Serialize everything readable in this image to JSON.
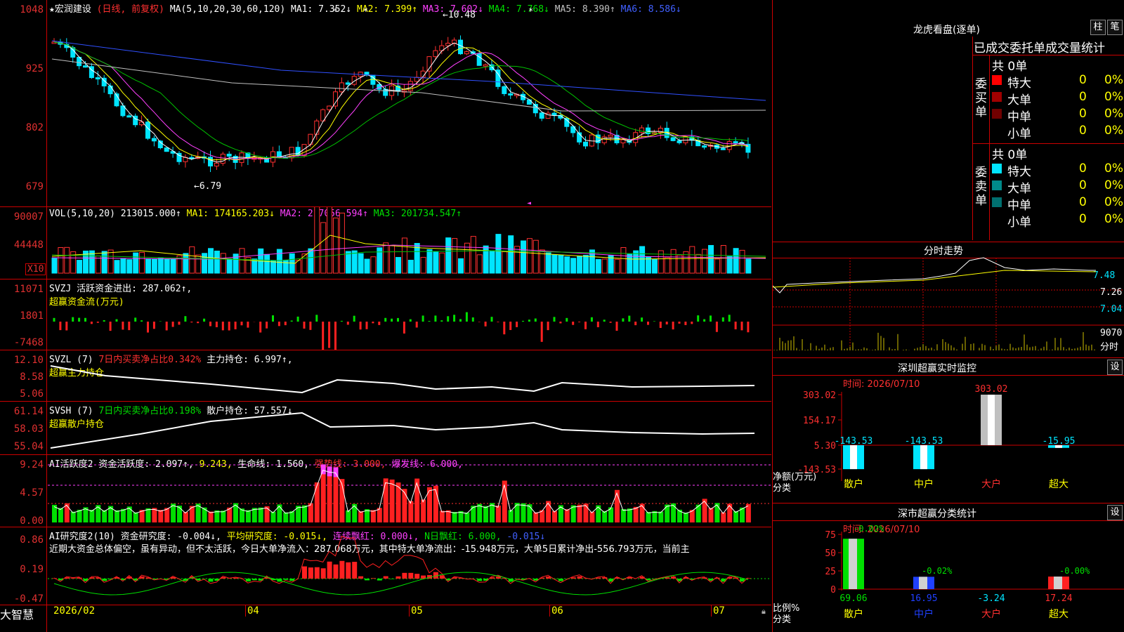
{
  "kline": {
    "star": "★",
    "name": "宏润建设",
    "period": "(日线, 前复权)",
    "ma_label": "MA(5,10,20,30,60,120)",
    "ma1": "MA1: 7.352↓",
    "ma2": "MA2: 7.399↑",
    "ma3": "MA3: 7.602↓",
    "ma4": "MA4: 7.768↓",
    "ma5": "MA5: 8.390↑",
    "ma6": "MA6: 8.586↓",
    "yticks": [
      "1048",
      "925",
      "802",
      "679"
    ],
    "high_mark": "10.48",
    "low_mark": "6.79",
    "colors": {
      "up": "#ff3030",
      "down": "#00e5ff",
      "ma1": "#ffffff",
      "ma2": "#ffff00",
      "ma3": "#ff40ff",
      "ma4": "#00c000",
      "ma5": "#c0c0c0",
      "ma6": "#3050ff"
    }
  },
  "vol": {
    "label": "VOL(5,10,20)",
    "v": "213015.000↑",
    "ma1": "MA1: 174165.203↓",
    "ma2": "MA2: 217056.594↑",
    "ma3": "MA3: 201734.547↑",
    "yticks": [
      "90007",
      "44448"
    ],
    "unit": "X10"
  },
  "svzj": {
    "label": "SVZJ",
    "title": "活跃资金进出: 287.062↑,",
    "sub": "超赢资金流(万元)",
    "yticks": [
      "11071",
      "1801",
      "-7468"
    ]
  },
  "svzl": {
    "label": "SVZL (7)",
    "pct": "7日内买卖净占比0.342%",
    "hold": "主力持仓: 6.997↑,",
    "sub": "超赢主力持仓",
    "yticks": [
      "12.10",
      "8.58",
      "5.06"
    ]
  },
  "svsh": {
    "label": "SVSH (7)",
    "pct": "7日内买卖净占比0.198%",
    "hold": "散户持仓: 57.557↓",
    "sub": "超赢散户持仓",
    "yticks": [
      "61.14",
      "58.03",
      "55.04"
    ]
  },
  "ai1": {
    "label": "AI活跃度2",
    "a": "资金活跃度: 2.097↑,",
    "b": "9.243,",
    "c": "生命线: 1.560,",
    "d": "强势线: 3.000,",
    "e": "爆发线: 6.000,",
    "yticks": [
      "9.24",
      "4.57",
      "0.00"
    ]
  },
  "ai2": {
    "label": "AI研究度2(10)",
    "a": "资金研究度: -0.004↓,",
    "b": "平均研究度: -0.015↓,",
    "c": "连续飘红: 0.000↓,",
    "d": "N日飘红: 6.000,",
    "e": "-0.015↓",
    "text": "近期大资金总体偏空，虽有异动，但不太活跃，今日大单净流入：287.068万元，其中特大单净流出：-15.948万元，大单5日累计净出-556.793万元，当前主",
    "yticks": [
      "0.86",
      "0.19",
      "-0.47"
    ]
  },
  "xaxis": {
    "brand": "大智慧",
    "labels": [
      "2026/02",
      "04",
      "05",
      "06",
      "07"
    ]
  },
  "lhb": {
    "title": "龙虎看盘(逐单)",
    "btn1": "柱",
    "btn2": "笔",
    "header": "已成交委托单成交量统计",
    "buy_side": "委买单",
    "sell_side": "委卖单",
    "buy_total": "共 0单",
    "sell_total": "共 0单",
    "buy_rows": [
      {
        "name": "特大",
        "count": "0",
        "pct": "0%",
        "color": "#ff0000"
      },
      {
        "name": "大单",
        "count": "0",
        "pct": "0%",
        "color": "#a00000"
      },
      {
        "name": "中单",
        "count": "0",
        "pct": "0%",
        "color": "#700000"
      },
      {
        "name": "小单",
        "count": "0",
        "pct": "0%",
        "color": "#000000"
      }
    ],
    "sell_rows": [
      {
        "name": "特大",
        "count": "0",
        "pct": "0%",
        "color": "#00e5ff"
      },
      {
        "name": "大单",
        "count": "0",
        "pct": "0%",
        "color": "#008a8a"
      },
      {
        "name": "中单",
        "count": "0",
        "pct": "0%",
        "color": "#007070"
      },
      {
        "name": "小单",
        "count": "0",
        "pct": "0%",
        "color": "#000000"
      }
    ]
  },
  "intraday": {
    "title": "分时走势",
    "yticks": [
      "7.48",
      "7.26",
      "7.04",
      "9070"
    ],
    "vol_label": "分时"
  },
  "monitor": {
    "title": "深圳超赢实时监控",
    "btn": "设",
    "time": "时间: 2026/07/10",
    "yticks": [
      "303.02",
      "154.17",
      "5.30",
      "-143.53"
    ],
    "values": [
      "-143.53",
      "-143.53",
      "303.02",
      "-15.95"
    ],
    "categories": [
      "散户",
      "中户",
      "大户",
      "超大"
    ],
    "ylabel1": "净额(万元)",
    "ylabel2": "分类"
  },
  "classify": {
    "title": "深市超赢分类统计",
    "btn": "设",
    "time": "时间: 2026/07/10",
    "yticks": [
      "75",
      "50",
      "25",
      "0"
    ],
    "top_labels": [
      "-0.02%",
      "-0.02%",
      "-0.00%"
    ],
    "values": [
      "69.06",
      "16.95",
      "-3.24",
      "17.24"
    ],
    "categories": [
      "散户",
      "中户",
      "大户",
      "超大"
    ],
    "ylabel1": "比例%",
    "ylabel2": "分类"
  }
}
